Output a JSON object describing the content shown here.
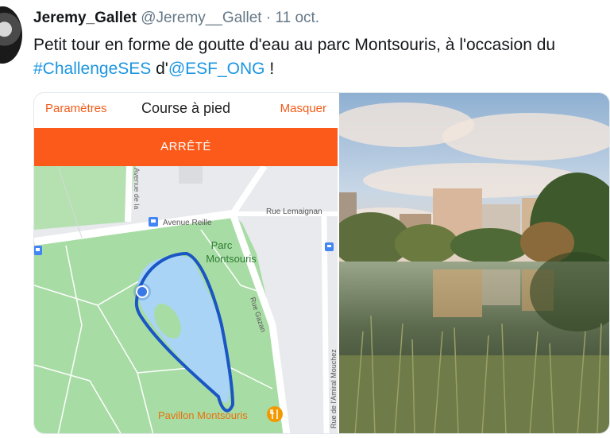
{
  "tweet": {
    "display_name": "Jeremy_Gallet",
    "handle": "@Jeremy__Gallet",
    "separator": "·",
    "date": "11 oct.",
    "text_part1": "Petit tour en forme de goutte d'eau au parc Montsouris, à l'occasion du ",
    "hashtag": "#ChallengeSES",
    "text_part2": " d'",
    "mention": "@ESF_ONG",
    "text_part3": " !"
  },
  "app": {
    "settings_label": "Paramètres",
    "activity_title": "Course à pied",
    "hide_label": "Masquer",
    "status_label": "ARRÊTÉ"
  },
  "map": {
    "labels": {
      "avenue_reille": "Avenue Reille",
      "rue_lemaignan": "Rue Lemaignan",
      "parc_line1": "Parc",
      "parc_line2": "Montsouris",
      "rue_gazan": "Rue Gazan",
      "rue_amiral": "Rue de l'Amiral Mouchez",
      "pavillon": "Pavillon Montsouris",
      "avenue_partial": "Avenue de la"
    }
  },
  "colors": {
    "accent_orange": "#fc5a1a",
    "link_blue": "#1b95e0",
    "route_blue": "#1a56c4",
    "park_green": "#a8dca5",
    "water_blue": "#a9d4f5"
  }
}
